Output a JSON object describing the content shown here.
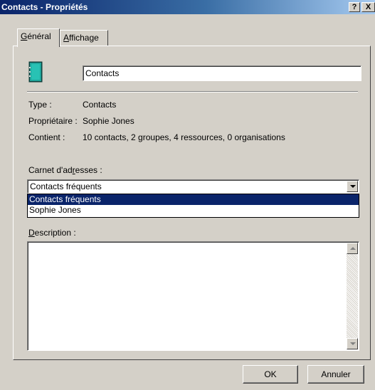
{
  "window": {
    "title": "Contacts - Propriétés",
    "help_button": "?",
    "close_button": "X"
  },
  "tabs": [
    {
      "label_first": "G",
      "label_rest": "énéral",
      "active": true
    },
    {
      "label_first": "A",
      "label_rest": "ffichage",
      "active": false
    }
  ],
  "general": {
    "icon": "address-book-icon",
    "name_value": "Contacts",
    "type_label": "Type :",
    "type_value": "Contacts",
    "owner_label": "Propriétaire :",
    "owner_value": "Sophie Jones",
    "contains_label": "Contient :",
    "contains_value": "10 contacts, 2 groupes, 4 ressources, 0 organisations",
    "addressbook_label_first": "Carnet d'ad",
    "addressbook_label_underline": "r",
    "addressbook_label_rest": "esses :",
    "addressbook_selected": "Contacts fréquents",
    "addressbook_options": [
      "Contacts fréquents",
      "Sophie Jones"
    ],
    "description_label_first": "D",
    "description_label_rest": "escription :",
    "description_value": ""
  },
  "buttons": {
    "ok": "OK",
    "cancel": "Annuler"
  },
  "colors": {
    "title_bar": "#0a246a",
    "selection": "#0a246a",
    "book_teal": "#1fa59a"
  }
}
